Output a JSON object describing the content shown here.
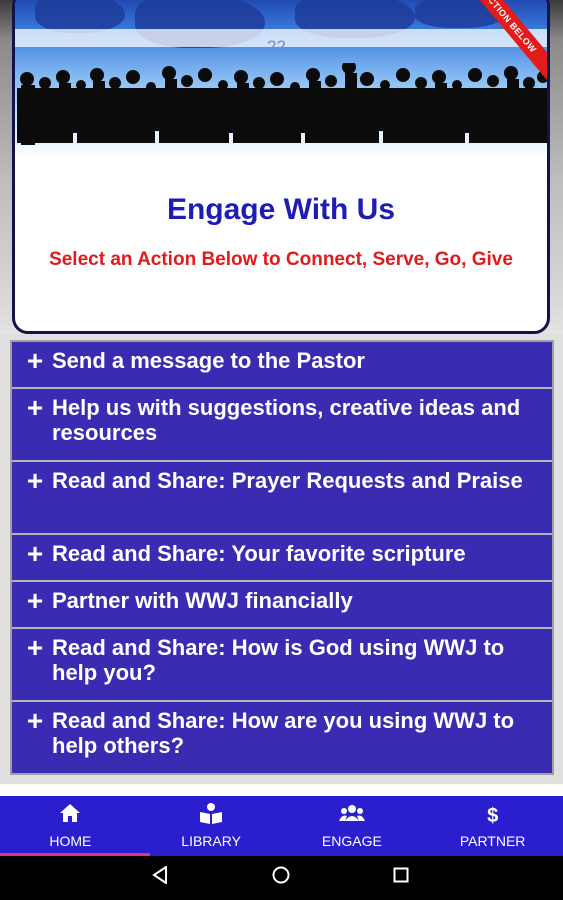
{
  "hero": {
    "banner_number": "22",
    "ribbon_text": "ACTION BELOW",
    "title": "Engage With Us",
    "subtitle": "Select an Action Below to Connect, Serve, Go, Give"
  },
  "actions": [
    {
      "label": "Send a message to the Pastor",
      "icon": "plus-icon"
    },
    {
      "label": "Help us with suggestions, creative ideas and resources",
      "icon": "plus-icon"
    },
    {
      "label": "Read and Share: Prayer Requests and Praise",
      "icon": "plus-icon"
    },
    {
      "label": "Read and Share: Your favorite scripture",
      "icon": "plus-icon"
    },
    {
      "label": "Partner with WWJ financially",
      "icon": "plus-icon"
    },
    {
      "label": "Read and Share: How is God using WWJ to help you?",
      "icon": "plus-icon"
    },
    {
      "label": "Read and Share: How are you using WWJ to help others?",
      "icon": "plus-icon"
    }
  ],
  "nav": [
    {
      "label": "HOME",
      "icon": "home-icon"
    },
    {
      "label": "LIBRARY",
      "icon": "book-reader-icon"
    },
    {
      "label": "ENGAGE",
      "icon": "users-icon"
    },
    {
      "label": "PARTNER",
      "icon": "dollar-icon"
    }
  ],
  "colors": {
    "accent": "#3a2bb3",
    "nav_bg": "#2a1ecf",
    "title": "#1d1db5",
    "subtitle": "#e01b1b",
    "active_indicator": "#e3327a"
  }
}
